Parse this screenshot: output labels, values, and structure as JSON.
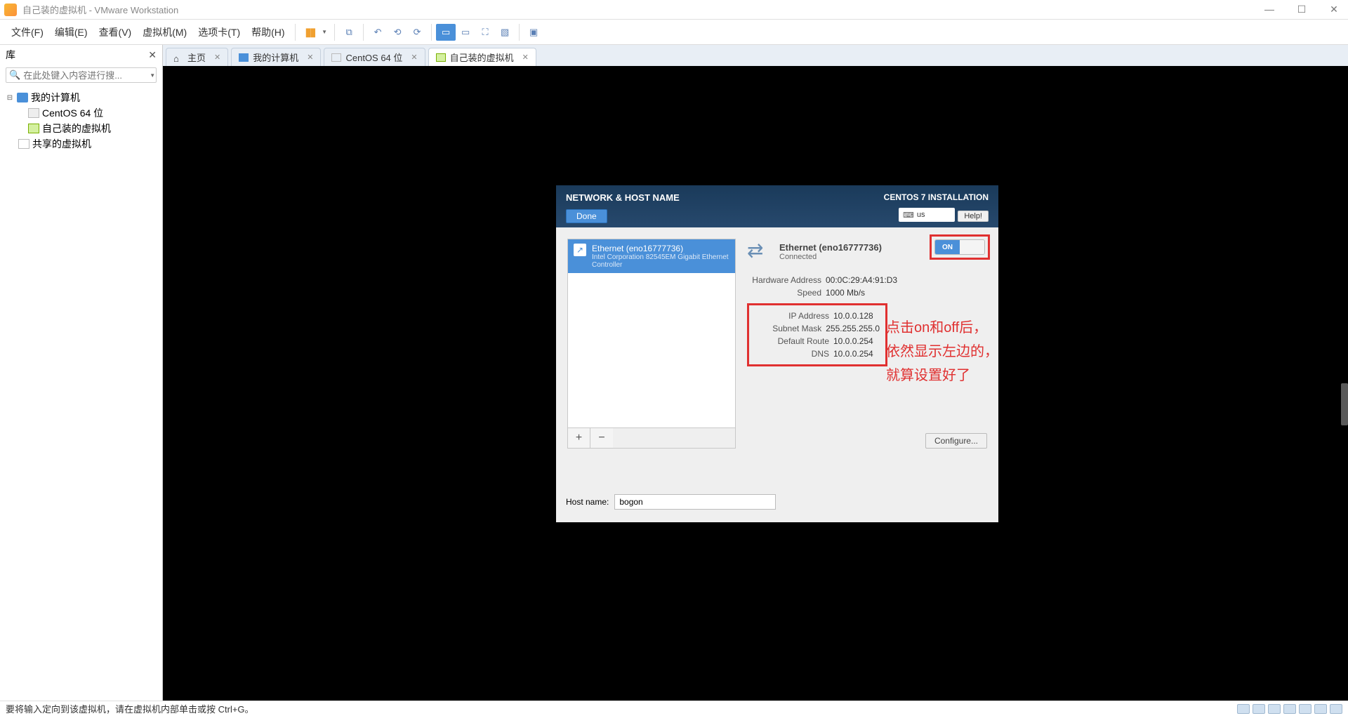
{
  "window": {
    "title": "自己装的虚拟机 - VMware Workstation"
  },
  "menu": {
    "file": "文件(F)",
    "edit": "编辑(E)",
    "view": "查看(V)",
    "vm": "虚拟机(M)",
    "tabs": "选项卡(T)",
    "help": "帮助(H)"
  },
  "sidebar": {
    "title": "库",
    "search_placeholder": "在此处键入内容进行搜...",
    "tree": {
      "root": "我的计算机",
      "vm1": "CentOS 64 位",
      "vm2": "自己装的虚拟机",
      "shared": "共享的虚拟机"
    }
  },
  "tabs": {
    "home": "主页",
    "t1": "我的计算机",
    "t2": "CentOS 64 位",
    "t3": "自己装的虚拟机"
  },
  "installer": {
    "title": "NETWORK & HOST NAME",
    "done": "Done",
    "product": "CENTOS 7 INSTALLATION",
    "lang": "us",
    "help": "Help!",
    "nic_name": "Ethernet (eno16777736)",
    "nic_sub": "Intel Corporation 82545EM Gigabit Ethernet Controller",
    "detail_name": "Ethernet (eno16777736)",
    "detail_status": "Connected",
    "switch": "ON",
    "rows": {
      "hw_label": "Hardware Address",
      "hw_val": "00:0C:29:A4:91:D3",
      "speed_label": "Speed",
      "speed_val": "1000 Mb/s",
      "ip_label": "IP Address",
      "ip_val": "10.0.0.128",
      "mask_label": "Subnet Mask",
      "mask_val": "255.255.255.0",
      "route_label": "Default Route",
      "route_val": "10.0.0.254",
      "dns_label": "DNS",
      "dns_val": "10.0.0.254"
    },
    "add": "+",
    "remove": "−",
    "configure": "Configure...",
    "host_label": "Host name:",
    "host_value": "bogon"
  },
  "annotation": {
    "line1": "点击on和off后，",
    "line2": "依然显示左边的，",
    "line3": "就算设置好了"
  },
  "statusbar": {
    "text": "要将输入定向到该虚拟机，请在虚拟机内部单击或按 Ctrl+G。"
  }
}
